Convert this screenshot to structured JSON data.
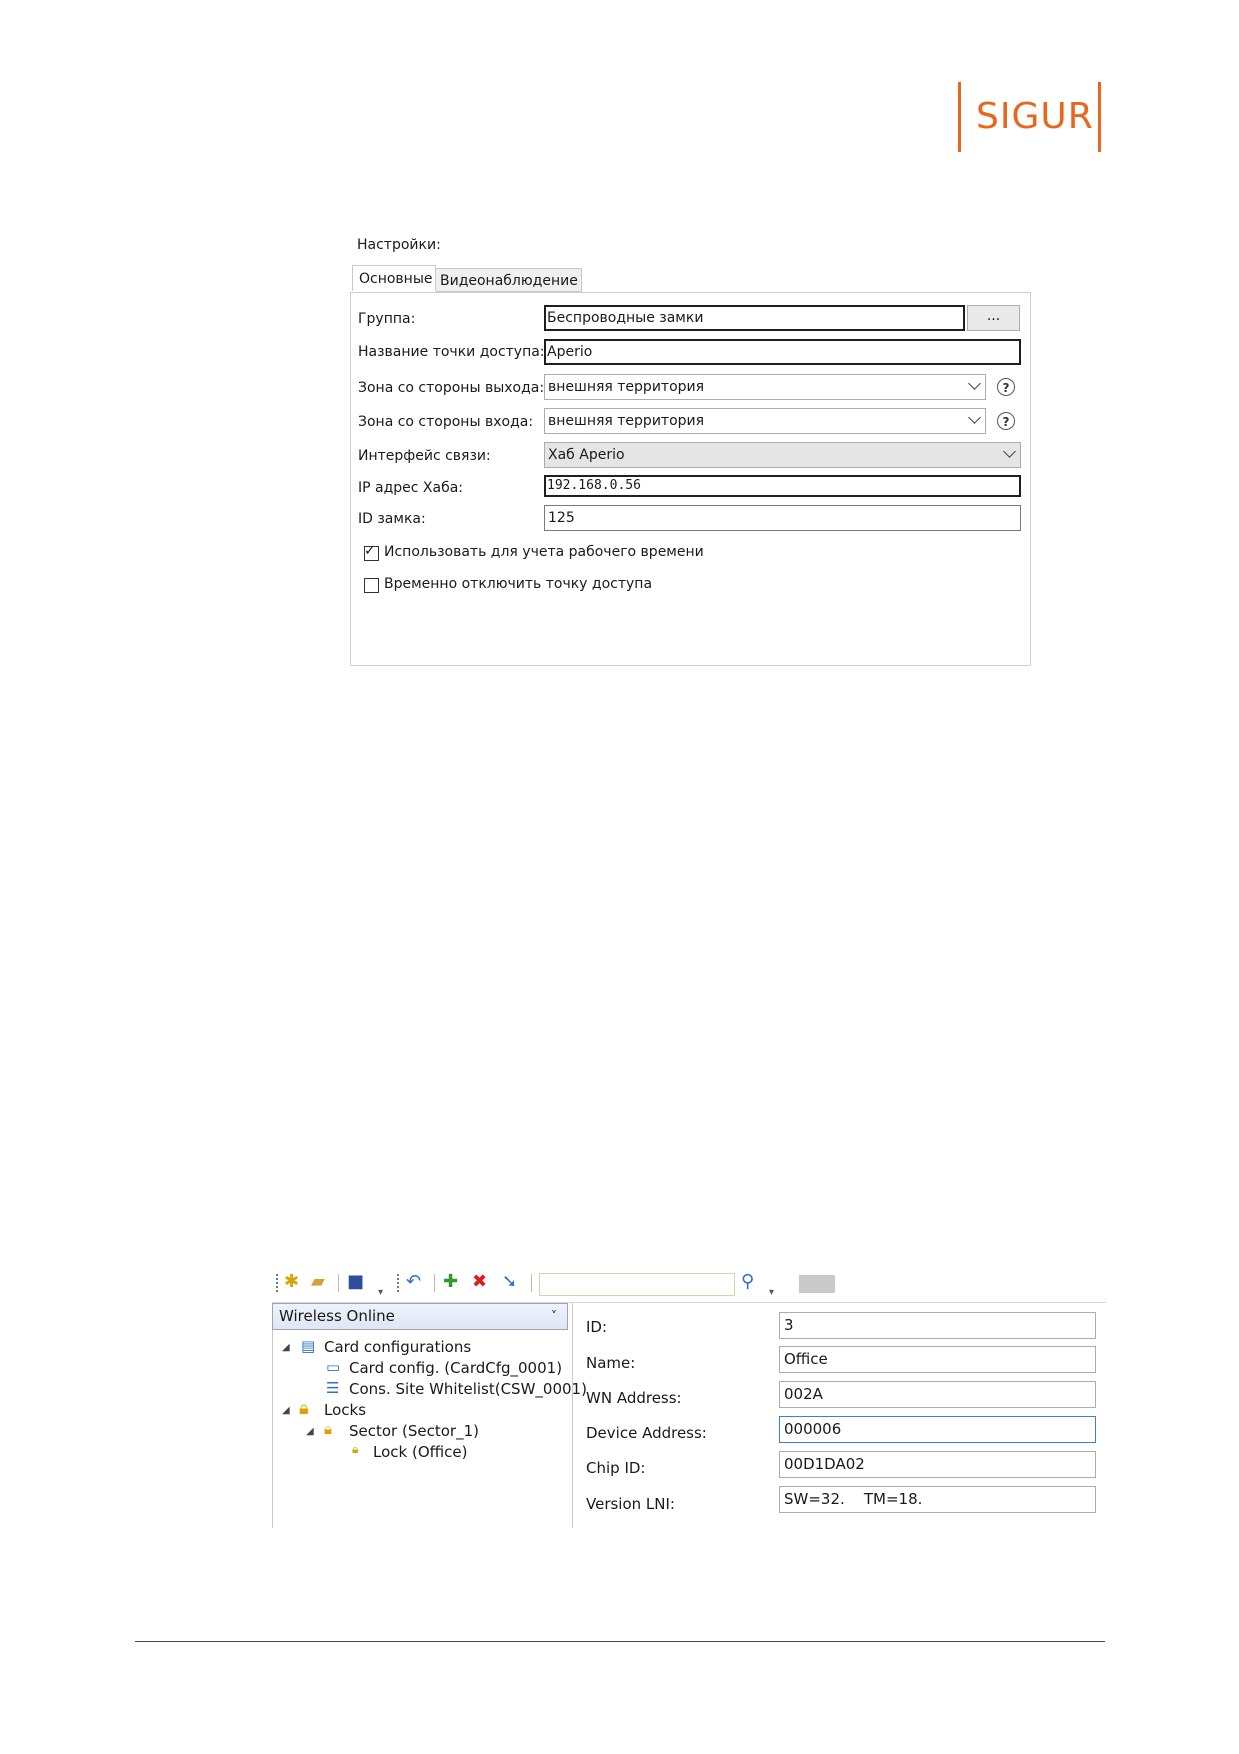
{
  "logo": {
    "text": "SIGUR"
  },
  "settings": {
    "title": "Настройки:",
    "tabs": [
      {
        "label": "Основные",
        "active": true
      },
      {
        "label": "Видеонаблюдение",
        "active": false
      }
    ],
    "fields": {
      "group": {
        "label": "Группа:",
        "value": "Беспроводные замки",
        "button": "..."
      },
      "name": {
        "label": "Название точки доступа:",
        "value": "Aperio"
      },
      "exit_zone": {
        "label": "Зона со стороны выхода:",
        "value": "внешняя территория"
      },
      "entry_zone": {
        "label": "Зона со стороны входа:",
        "value": "внешняя территория"
      },
      "interface": {
        "label": "Интерфейс связи:",
        "value": "Хаб Aperio"
      },
      "hub_ip": {
        "label": "IP адрес Хаба:",
        "value": "192.168.0.56"
      },
      "lock_id": {
        "label": "ID замка:",
        "value": "125"
      }
    },
    "checkboxes": [
      {
        "label": "Использовать для учета рабочего времени",
        "checked": true
      },
      {
        "label": "Временно отключить точку доступа",
        "checked": false
      }
    ],
    "help_glyph": "?"
  },
  "wireless": {
    "dropdown": "Wireless Online",
    "dropdown_arrow": "˅",
    "tree": [
      {
        "label": "Card configurations",
        "icon": "card-config-folder-icon"
      },
      {
        "label": "Card config. (CardCfg_0001)",
        "icon": "card-icon"
      },
      {
        "label": "Cons. Site Whitelist(CSW_0001)",
        "icon": "list-icon"
      },
      {
        "label": "Locks",
        "icon": "lock-folder-icon"
      },
      {
        "label": "Sector (Sector_1)",
        "icon": "lock-icon"
      },
      {
        "label": "Lock (Office)",
        "icon": "small-lock-icon"
      }
    ],
    "properties": [
      {
        "label": "ID:",
        "value": "3"
      },
      {
        "label": "Name:",
        "value": "Office"
      },
      {
        "label": "WN Address:",
        "value": "002A"
      },
      {
        "label": "Device Address:",
        "value": "000006"
      },
      {
        "label": "Chip ID:",
        "value": "00D1DA02"
      },
      {
        "label": "Version LNI:",
        "value": "SW=32.    TM=18."
      }
    ]
  }
}
